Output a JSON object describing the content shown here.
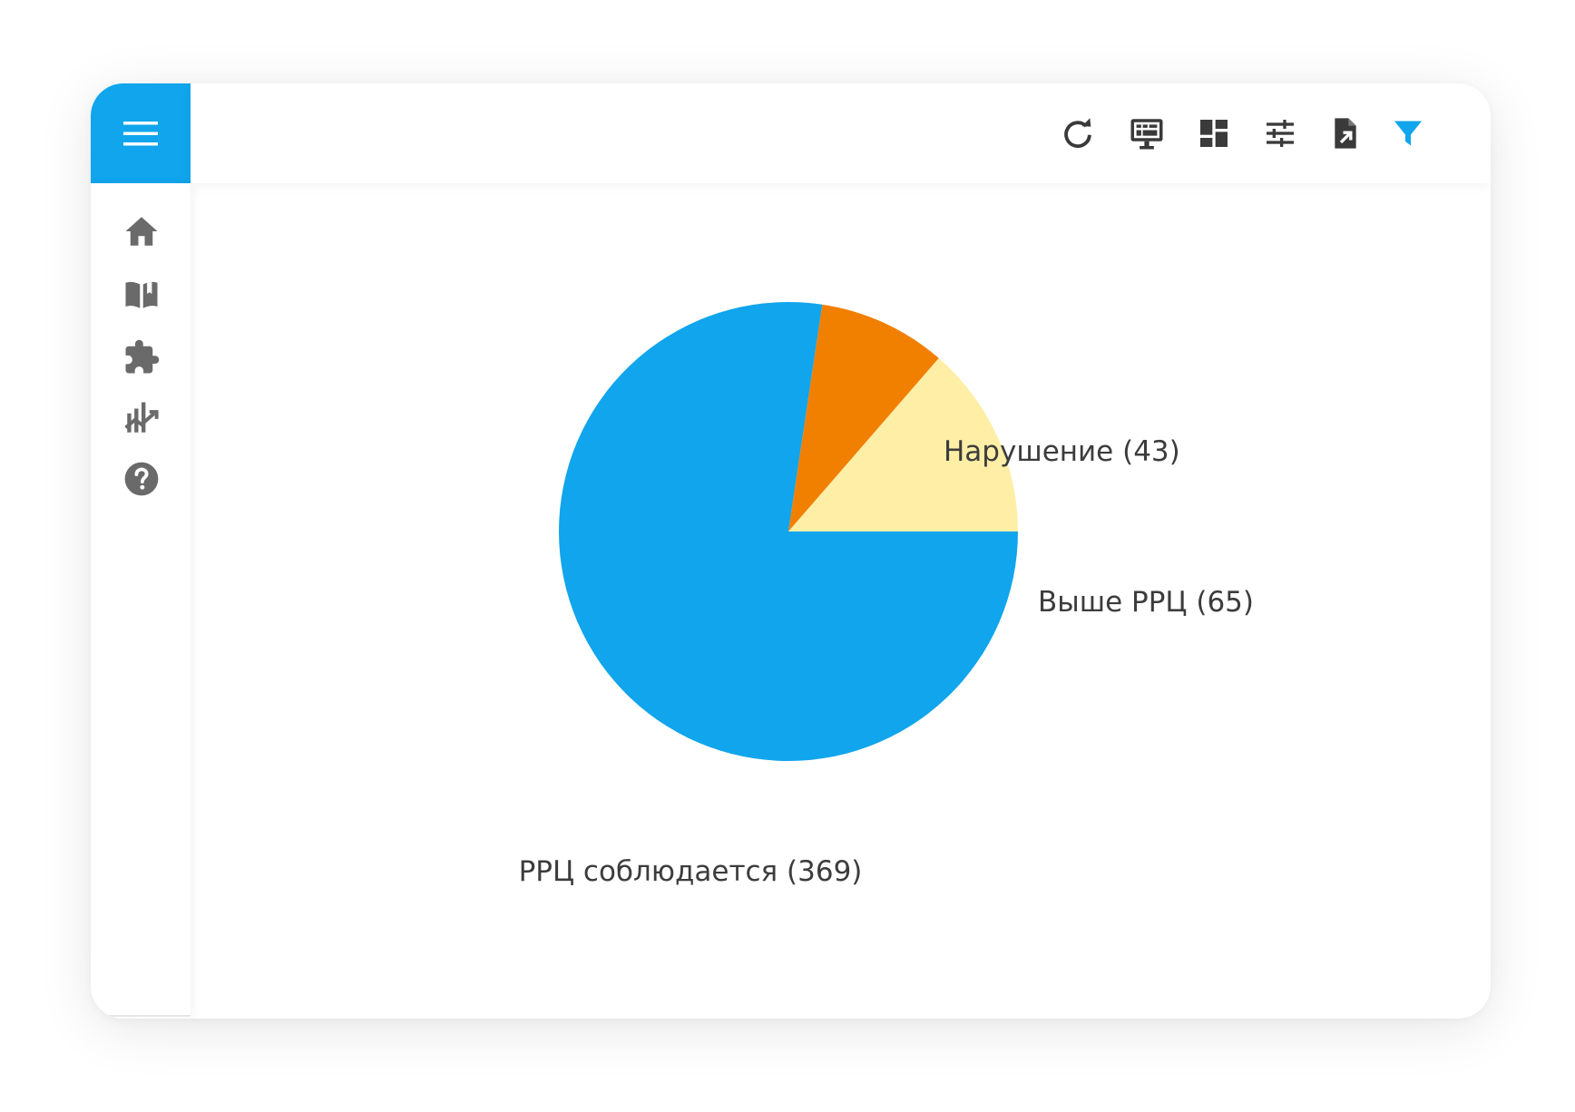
{
  "colors": {
    "accent": "#10a5ec",
    "icon_dark": "#3a3a3a",
    "icon_gray": "#666666",
    "filter_active": "#10a5ec"
  },
  "menu": {
    "icon": "hamburger-icon"
  },
  "toolbar": {
    "icons": [
      "refresh-icon",
      "monitor-icon",
      "dashboard-icon",
      "tune-icon",
      "export-file-icon",
      "filter-icon"
    ]
  },
  "sidebar": {
    "items": [
      "home-icon",
      "book-icon",
      "puzzle-icon",
      "analytics-icon",
      "help-icon"
    ],
    "footer": "mascot-logo"
  },
  "chart_data": {
    "type": "pie",
    "slices": [
      {
        "label": "РРЦ соблюдается (369)",
        "name": "РРЦ соблюдается",
        "value": 369,
        "color": "#10a5ec"
      },
      {
        "label": "Нарушение (43)",
        "name": "Нарушение",
        "value": 43,
        "color": "#f17f00"
      },
      {
        "label": "Выше РРЦ (65)",
        "name": "Выше РРЦ",
        "value": 65,
        "color": "#ffeea6"
      }
    ],
    "start": "3 o'clock",
    "direction": "clockwise",
    "title": ""
  }
}
